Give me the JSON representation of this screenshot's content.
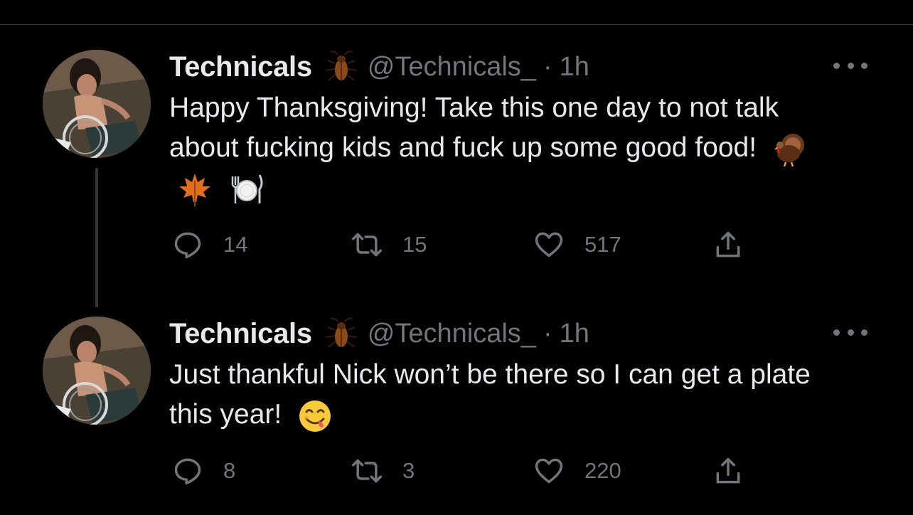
{
  "tweets": [
    {
      "display_name": "Technicals",
      "name_emoji": "cockroach-icon",
      "handle": "@Technicals_",
      "separator": "·",
      "time": "1h",
      "text": "Happy Thanksgiving! Take this one day to not talk about fucking kids and fuck up some good food!",
      "emojis": [
        "turkey-icon",
        "maple-leaf-icon",
        "plate-cutlery-icon"
      ],
      "replies": "14",
      "retweets": "15",
      "likes": "517"
    },
    {
      "display_name": "Technicals",
      "name_emoji": "cockroach-icon",
      "handle": "@Technicals_",
      "separator": "·",
      "time": "1h",
      "text": "Just thankful Nick won’t be there so I can get a plate this year!",
      "emojis": [
        "yum-face-icon"
      ],
      "replies": "8",
      "retweets": "3",
      "likes": "220"
    }
  ],
  "colors": {
    "background": "#000000",
    "text_primary": "#e7e9ea",
    "text_secondary": "#71767b",
    "thread_line": "#333639"
  }
}
